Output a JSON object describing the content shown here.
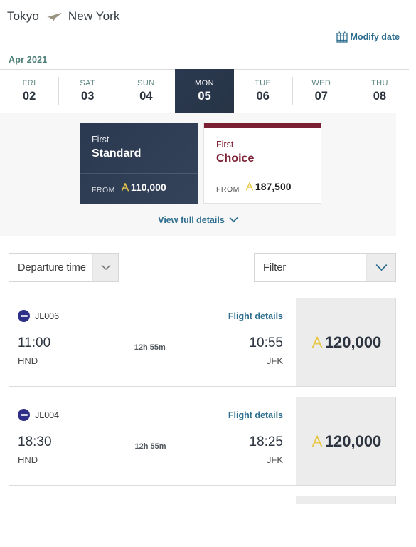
{
  "header": {
    "origin": "Tokyo",
    "destination": "New York",
    "plane_icon": "airplane-icon",
    "modify_date_label": "Modify date",
    "calendar_icon": "calendar-icon"
  },
  "date_selector": {
    "month_label": "Apr 2021",
    "days": [
      {
        "dow": "FRI",
        "num": "02",
        "selected": false
      },
      {
        "dow": "SAT",
        "num": "03",
        "selected": false
      },
      {
        "dow": "SUN",
        "num": "04",
        "selected": false
      },
      {
        "dow": "MON",
        "num": "05",
        "selected": true
      },
      {
        "dow": "TUE",
        "num": "06",
        "selected": false
      },
      {
        "dow": "WED",
        "num": "07",
        "selected": false
      },
      {
        "dow": "THU",
        "num": "08",
        "selected": false
      }
    ]
  },
  "fares": {
    "cards": [
      {
        "cabin": "First",
        "name": "Standard",
        "from_label": "FROM",
        "price": "110,000",
        "selected": true,
        "accent_color": "#2b3950"
      },
      {
        "cabin": "First",
        "name": "Choice",
        "from_label": "FROM",
        "price": "187,500",
        "selected": false,
        "accent_color": "#7b1f34"
      }
    ],
    "view_details_label": "View full details",
    "chevron_icon": "chevron-down-icon"
  },
  "controls": {
    "sort": {
      "label": "Departure time",
      "caret_icon": "chevron-down-icon"
    },
    "filter": {
      "label": "Filter",
      "caret_icon": "chevron-down-icon"
    }
  },
  "flights": [
    {
      "airline_icon": "airline-logo-icon",
      "flight_number": "JL006",
      "details_label": "Flight details",
      "depart_time": "11:00",
      "depart_airport": "HND",
      "duration": "12h 55m",
      "arrive_time": "10:55",
      "arrive_airport": "JFK",
      "price": "120,000"
    },
    {
      "airline_icon": "airline-logo-icon",
      "flight_number": "JL004",
      "details_label": "Flight details",
      "depart_time": "18:30",
      "depart_airport": "HND",
      "duration": "12h 55m",
      "arrive_time": "18:25",
      "arrive_airport": "JFK",
      "price": "120,000"
    }
  ],
  "colors": {
    "link": "#2e6e8e",
    "selected_day": "#2b3950",
    "fare_choice_accent": "#7b1f34",
    "month_label": "#4c7f76",
    "mile_symbol": "#e8c84a",
    "price_cell_bg": "#ececec"
  }
}
